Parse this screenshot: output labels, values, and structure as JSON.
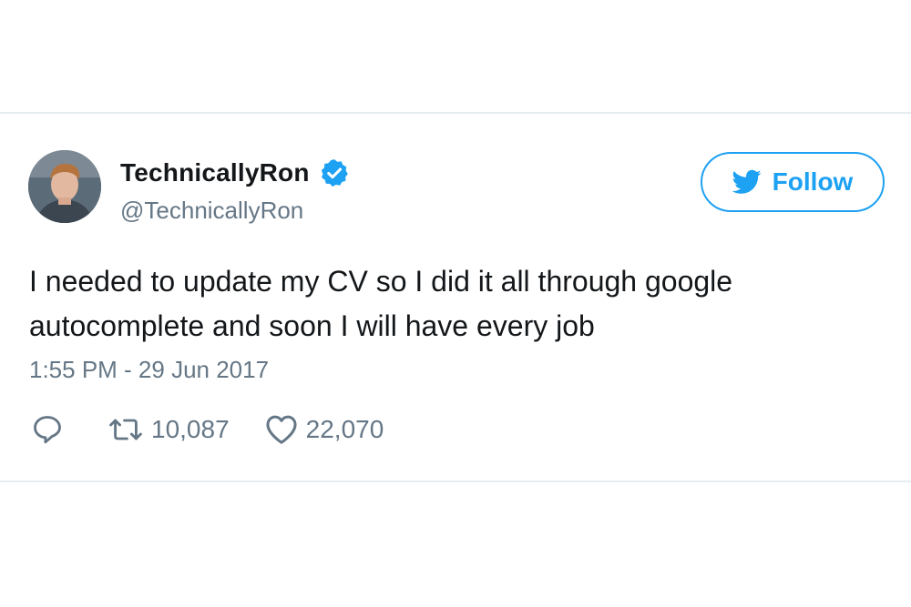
{
  "tweet": {
    "display_name": "TechnicallyRon",
    "handle": "@TechnicallyRon",
    "verified": true,
    "text_line1": "I needed to update my CV so I did it all through google",
    "text_line2": "autocomplete and soon I will have every job",
    "timestamp": "1:55 PM - 29 Jun 2017",
    "retweets": "10,087",
    "likes": "22,070"
  },
  "follow_button": {
    "label": "Follow",
    "icon": "twitter-bird-icon"
  },
  "colors": {
    "brand": "#1da1f2",
    "text": "#14171a",
    "secondary": "#657786",
    "divider": "#e6ecf0"
  }
}
